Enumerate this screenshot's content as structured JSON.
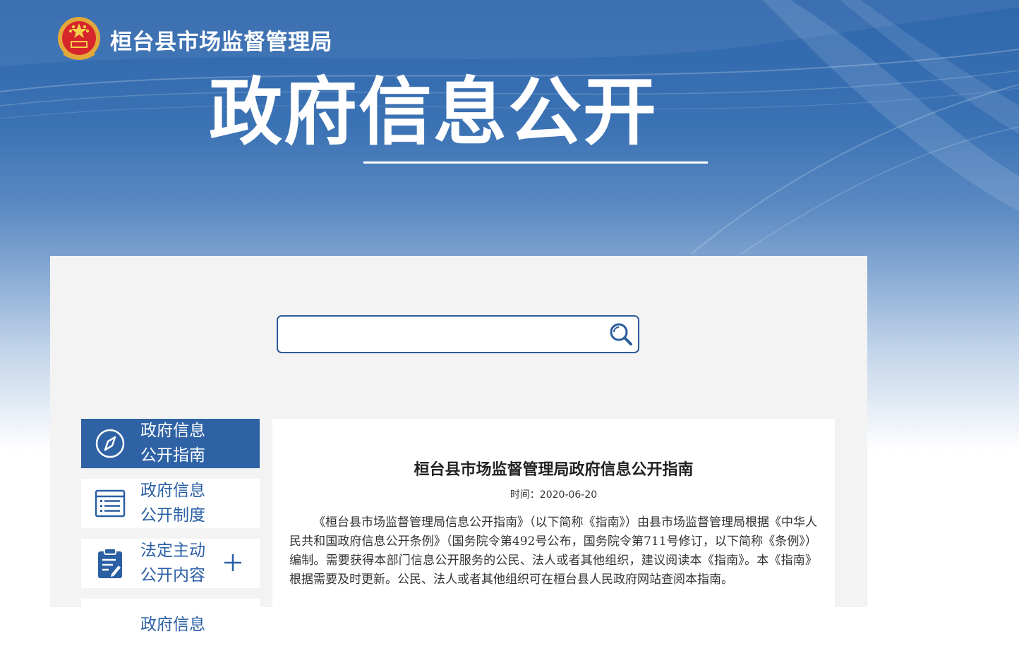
{
  "header": {
    "site_name": "桓台县市场监督管理局",
    "hero_title": "政府信息公开"
  },
  "search": {
    "value": "",
    "placeholder": ""
  },
  "sidebar": {
    "items": [
      {
        "line1": "政府信息",
        "line2": "公开指南",
        "icon": "compass-icon",
        "active": true
      },
      {
        "line1": "政府信息",
        "line2": "公开制度",
        "icon": "list-document-icon",
        "active": false
      },
      {
        "line1": "法定主动",
        "line2": "公开内容",
        "icon": "clipboard-edit-icon",
        "active": false,
        "expandable": true
      },
      {
        "line1": "政府信息",
        "line2": "",
        "icon": "",
        "active": false
      }
    ]
  },
  "article": {
    "title": "桓台县市场监督管理局政府信息公开指南",
    "meta": "时间：2020-06-20",
    "body": "《桓台县市场监督管理局信息公开指南》（以下简称《指南》）由县市场监督管理局根据《中华人民共和国政府信息公开条例》（国务院令第492号公布，国务院令第711号修订，以下简称《条例》）编制。需要获得本部门信息公开服务的公民、法人或者其他组织，建议阅读本《指南》。本《指南》根据需要及时更新。公民、法人或者其他组织可在桓台县人民政府网站查阅本指南。"
  },
  "colors": {
    "primary": "#2e62a5",
    "banner_top": "#2f67ad",
    "panel_bg": "#f3f3f3"
  }
}
